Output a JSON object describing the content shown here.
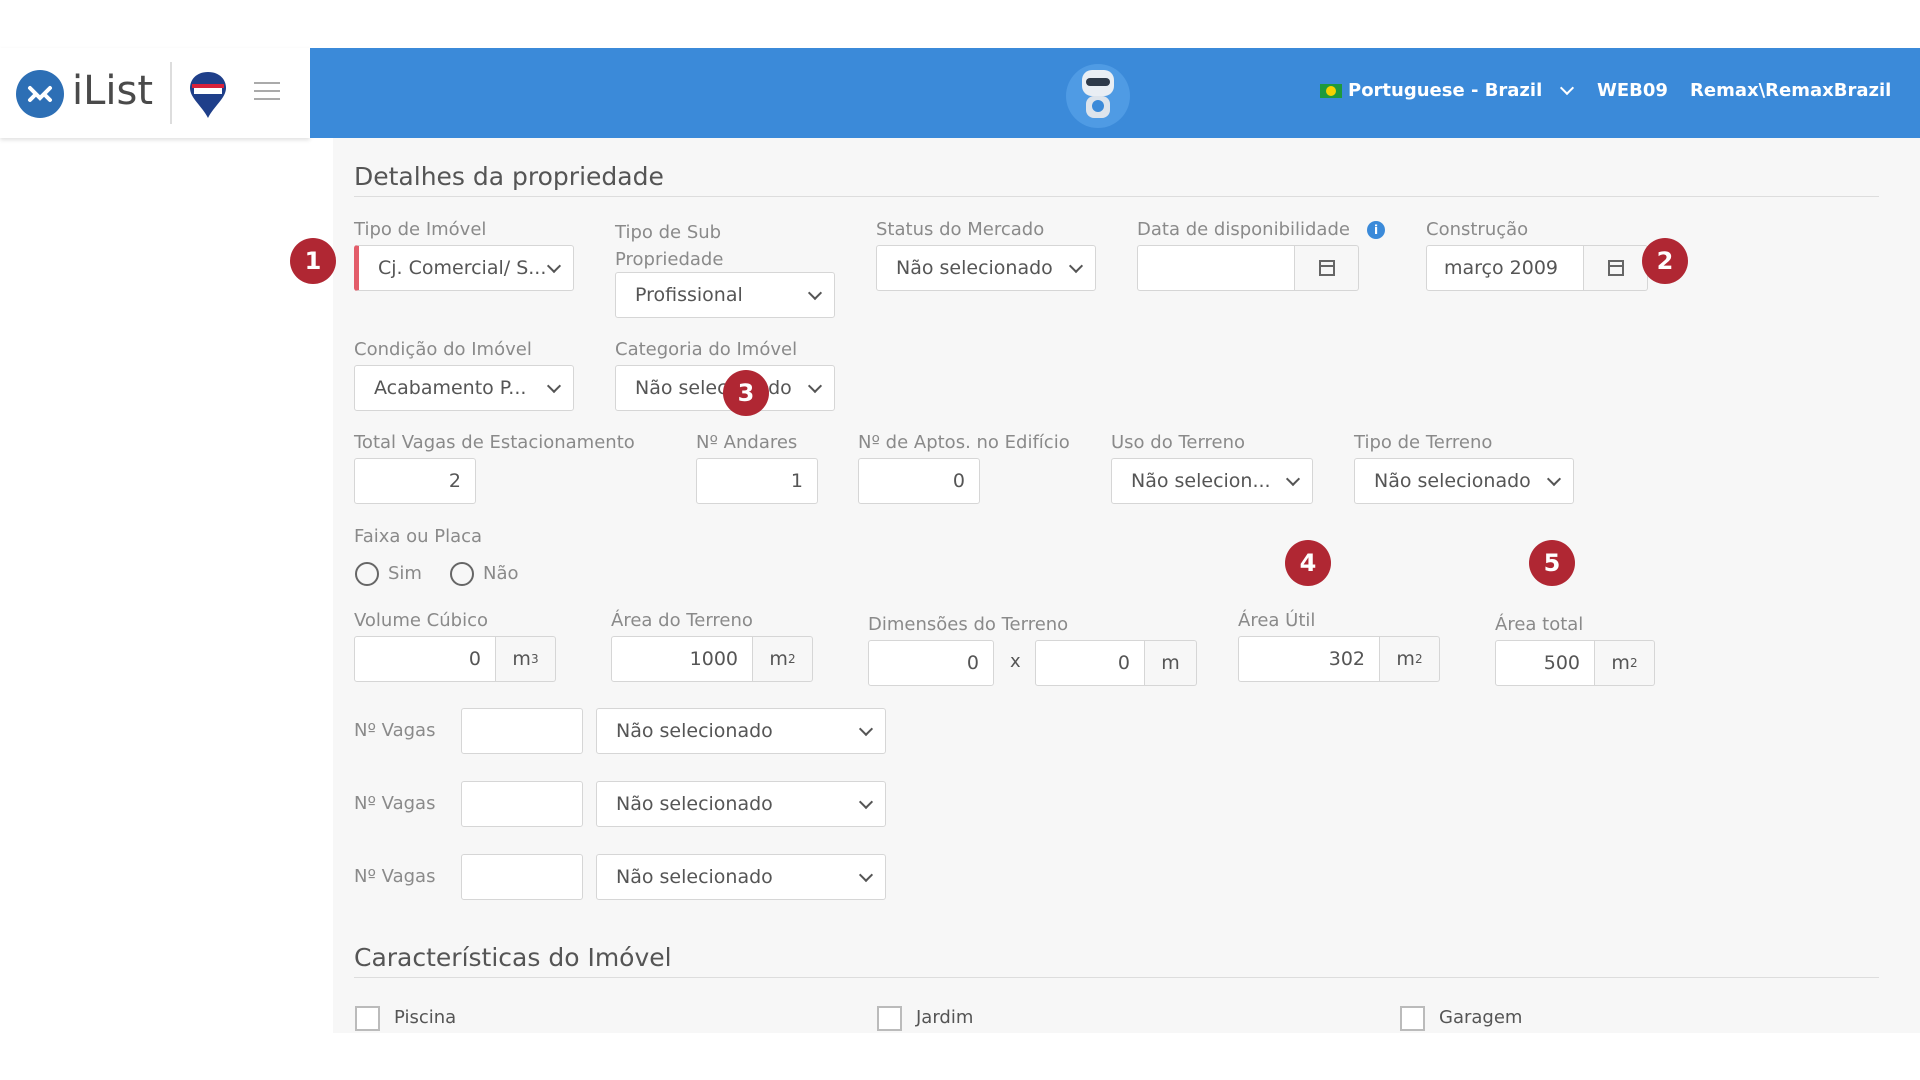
{
  "header": {
    "brand": "iList",
    "language": "Portuguese - Brazil",
    "server": "WEB09",
    "user": "Remax\\RemaxBrazil"
  },
  "section1": {
    "title": "Detalhes da propriedade",
    "tipo_imovel": {
      "label": "Tipo de Imóvel",
      "value": "Cj. Comercial/ S..."
    },
    "tipo_sub": {
      "label": "Tipo de Sub Propriedade",
      "value": "Profissional"
    },
    "status_mercado": {
      "label": "Status do Mercado",
      "value": "Não selecionado"
    },
    "data_disp": {
      "label": "Data de disponibilidade",
      "value": ""
    },
    "construcao": {
      "label": "Construção",
      "value": "março 2009"
    },
    "condicao": {
      "label": "Condição do Imóvel",
      "value": "Acabamento P..."
    },
    "categoria": {
      "label": "Categoria do Imóvel",
      "value": "Não selecionado"
    },
    "vagas_estac": {
      "label": "Total Vagas de Estacionamento",
      "value": "2"
    },
    "andares": {
      "label": "Nº Andares",
      "value": "1"
    },
    "aptos": {
      "label": "Nº de Aptos. no Edifício",
      "value": "0"
    },
    "uso_terreno": {
      "label": "Uso do Terreno",
      "value": "Não selecion..."
    },
    "tipo_terreno": {
      "label": "Tipo de Terreno",
      "value": "Não selecionado"
    },
    "faixa": {
      "label": "Faixa ou Placa",
      "opt_yes": "Sim",
      "opt_no": "Não"
    },
    "volume": {
      "label": "Volume Cúbico",
      "value": "0",
      "unit": "m",
      "unit_sup": "3"
    },
    "area_terreno": {
      "label": "Área do Terreno",
      "value": "1000",
      "unit": "m",
      "unit_sup": "2"
    },
    "dimensoes": {
      "label": "Dimensões do Terreno",
      "value1": "0",
      "sep": "x",
      "value2": "0",
      "unit": "m"
    },
    "area_util": {
      "label": "Área Útil",
      "value": "302",
      "unit": "m",
      "unit_sup": "2"
    },
    "area_total": {
      "label": "Área total",
      "value": "500",
      "unit": "m",
      "unit_sup": "2"
    },
    "vagas_rows": [
      {
        "label": "Nº Vagas",
        "value": "",
        "select": "Não selecionado"
      },
      {
        "label": "Nº Vagas",
        "value": "",
        "select": "Não selecionado"
      },
      {
        "label": "Nº Vagas",
        "value": "",
        "select": "Não selecionado"
      }
    ]
  },
  "section2": {
    "title": "Características do Imóvel",
    "items": [
      "Piscina",
      "Jardim",
      "Garagem"
    ]
  },
  "badges": [
    "1",
    "2",
    "3",
    "4",
    "5"
  ],
  "colors": {
    "topbar": "#3b8ad9",
    "badge": "#b02733",
    "required": "#e35d6a"
  }
}
